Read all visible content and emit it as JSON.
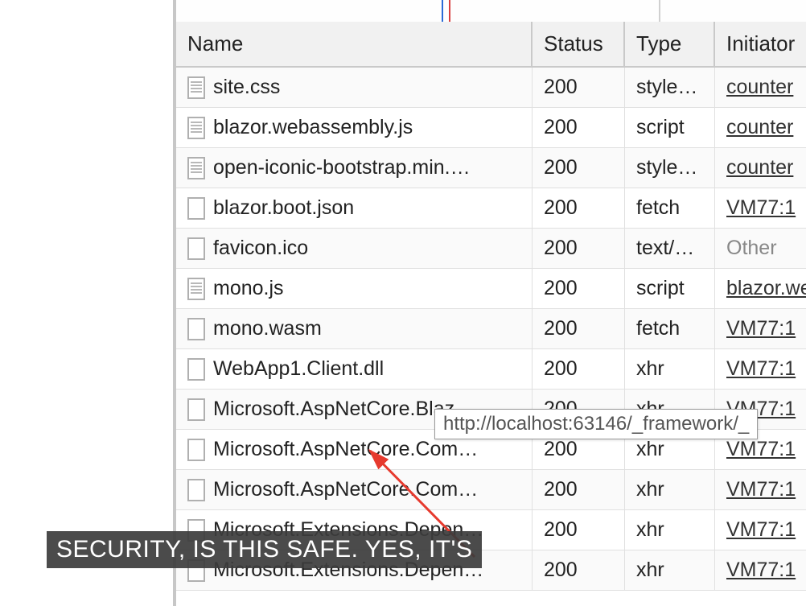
{
  "headers": {
    "name": "Name",
    "status": "Status",
    "type": "Type",
    "initiator": "Initiator"
  },
  "rows": [
    {
      "name": "site.css",
      "status": "200",
      "type": "style…",
      "initiator": "counter",
      "linked": true,
      "icon": "lines"
    },
    {
      "name": "blazor.webassembly.js",
      "status": "200",
      "type": "script",
      "initiator": "counter",
      "linked": true,
      "icon": "lines"
    },
    {
      "name": "open-iconic-bootstrap.min.…",
      "status": "200",
      "type": "style…",
      "initiator": "counter",
      "linked": true,
      "icon": "lines"
    },
    {
      "name": "blazor.boot.json",
      "status": "200",
      "type": "fetch",
      "initiator": "VM77:1",
      "linked": true,
      "icon": "plain"
    },
    {
      "name": "favicon.ico",
      "status": "200",
      "type": "text/…",
      "initiator": "Other",
      "linked": false,
      "icon": "plain"
    },
    {
      "name": "mono.js",
      "status": "200",
      "type": "script",
      "initiator": "blazor.we",
      "linked": true,
      "icon": "lines"
    },
    {
      "name": "mono.wasm",
      "status": "200",
      "type": "fetch",
      "initiator": "VM77:1",
      "linked": true,
      "icon": "plain"
    },
    {
      "name": "WebApp1.Client.dll",
      "status": "200",
      "type": "xhr",
      "initiator": "VM77:1",
      "linked": true,
      "icon": "plain"
    },
    {
      "name": "Microsoft.AspNetCore.Blaz…",
      "status": "200",
      "type": "xhr",
      "initiator": "VM77:1",
      "linked": true,
      "icon": "plain"
    },
    {
      "name": "Microsoft.AspNetCore.Com…",
      "status": "200",
      "type": "xhr",
      "initiator": "VM77:1",
      "linked": true,
      "icon": "plain"
    },
    {
      "name": "Microsoft.AspNetCore.Com…",
      "status": "200",
      "type": "xhr",
      "initiator": "VM77:1",
      "linked": true,
      "icon": "plain"
    },
    {
      "name": "Microsoft.Extensions.Depen…",
      "status": "200",
      "type": "xhr",
      "initiator": "VM77:1",
      "linked": true,
      "icon": "plain"
    },
    {
      "name": "Microsoft.Extensions.Depen…",
      "status": "200",
      "type": "xhr",
      "initiator": "VM77:1",
      "linked": true,
      "icon": "plain"
    }
  ],
  "tooltip": "http://localhost:63146/_framework/_",
  "caption": "SECURITY, IS THIS SAFE. YES, IT'S"
}
